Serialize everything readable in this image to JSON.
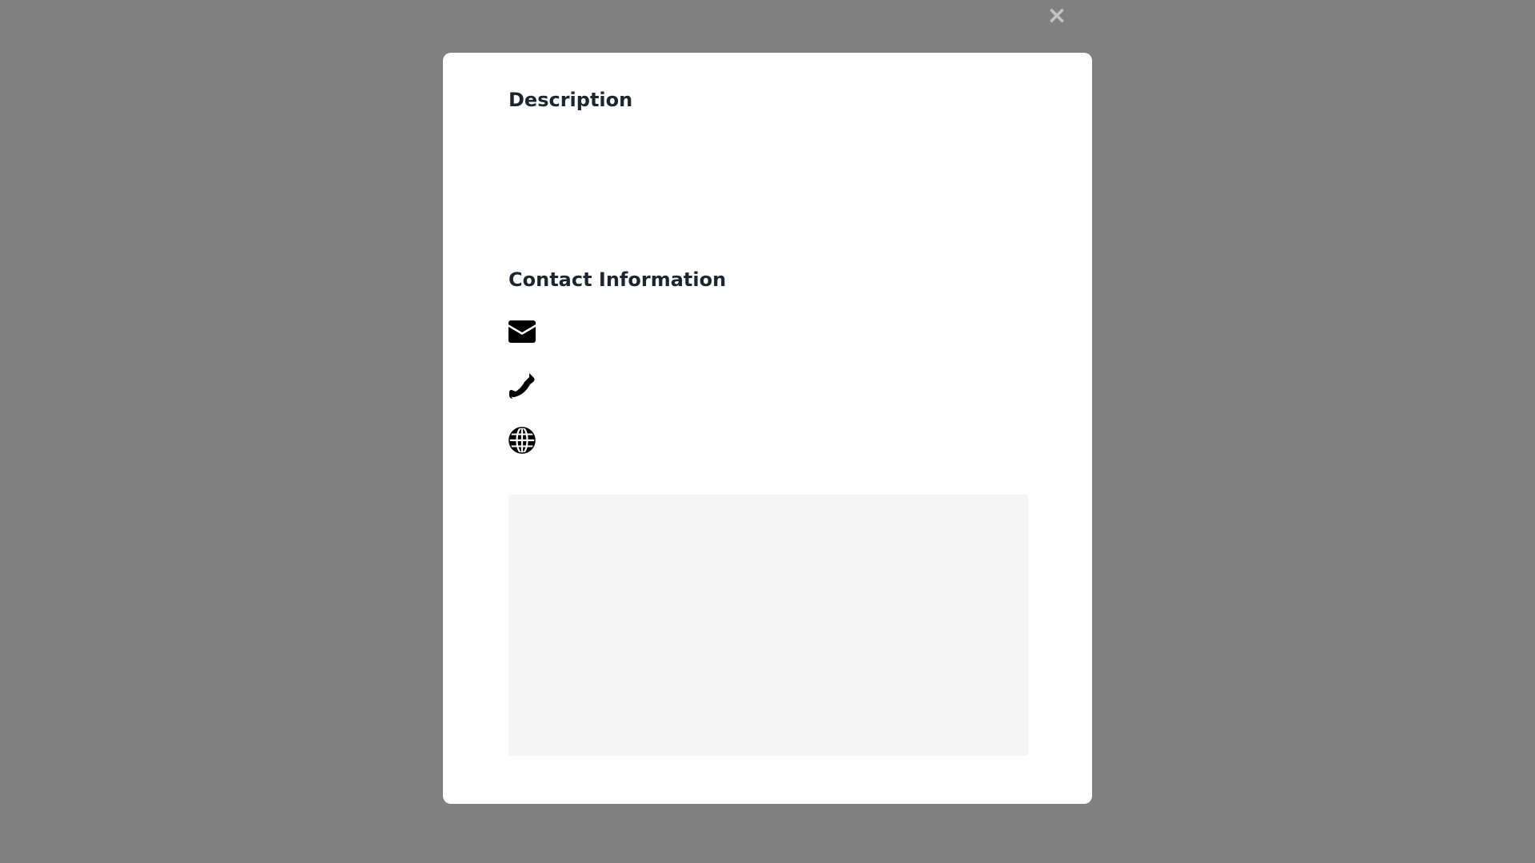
{
  "modal": {
    "close_glyph": "×",
    "description": {
      "title": "Description",
      "body": ""
    },
    "contact": {
      "title": "Contact Information",
      "items": [
        {
          "icon": "envelope-icon",
          "value": ""
        },
        {
          "icon": "phone-icon",
          "value": ""
        },
        {
          "icon": "globe-icon",
          "value": ""
        }
      ]
    }
  },
  "colors": {
    "backdrop": "#808080",
    "modal_bg": "#ffffff",
    "heading": "#1f2530",
    "close_icon": "#c4c4c4",
    "map_placeholder": "#f5f5f5"
  }
}
